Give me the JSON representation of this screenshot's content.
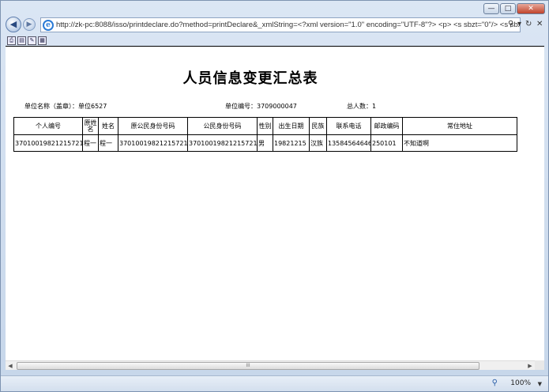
{
  "browser": {
    "url": "http://zk-pc:8088/isso/printdeclare.do?method=printDeclare&_xmlString=<?xml version=\"1.0\" encoding=\"UTF-8\"?> <p> <s sbzt=\"0\"/> <s sbxmb",
    "zoom": "100%",
    "scroll_mark": "III"
  },
  "report": {
    "title": "人员信息变更汇总表",
    "unit_name": "单位名称（盖章）：单位6527",
    "unit_code": "单位编号：3709000047",
    "total": "总人数：1",
    "headers": [
      "个人编号",
      "原姓名",
      "姓名",
      "原公民身份号码",
      "公民身份号码",
      "性别",
      "出生日期",
      "民族",
      "联系电话",
      "邮政编码",
      "常住地址"
    ],
    "rows": [
      [
        "370100198212157217",
        "程一",
        "程一",
        "370100198212157217",
        "370100198212157217",
        "男",
        "19821215",
        "汉族",
        "13584564646",
        "250101",
        "不知道啊"
      ]
    ]
  }
}
